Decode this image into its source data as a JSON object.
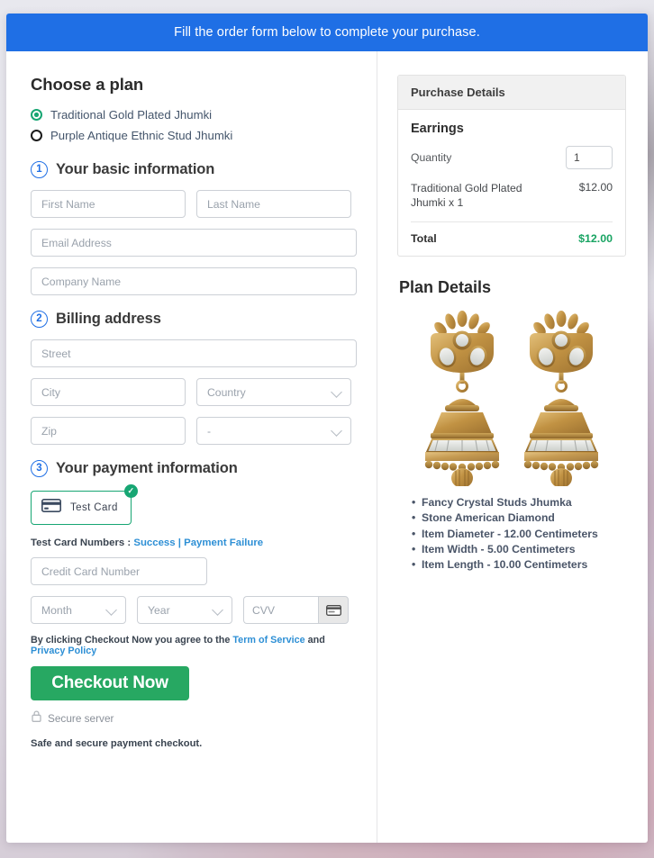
{
  "banner": {
    "text": "Fill the order form below to complete your purchase."
  },
  "plans": {
    "title": "Choose a plan",
    "options": [
      {
        "label": "Traditional Gold Plated Jhumki",
        "selected": true
      },
      {
        "label": "Purple Antique Ethnic Stud Jhumki",
        "selected": false
      }
    ]
  },
  "steps": {
    "basic": {
      "num": "1",
      "label": "Your basic information"
    },
    "billing": {
      "num": "2",
      "label": "Billing address"
    },
    "payment": {
      "num": "3",
      "label": "Your payment information"
    }
  },
  "fields": {
    "first_name": {
      "placeholder": "First Name",
      "value": ""
    },
    "last_name": {
      "placeholder": "Last Name",
      "value": ""
    },
    "email": {
      "placeholder": "Email Address",
      "value": ""
    },
    "company": {
      "placeholder": "Company Name",
      "value": ""
    },
    "street": {
      "placeholder": "Street",
      "value": ""
    },
    "city": {
      "placeholder": "City",
      "value": ""
    },
    "country": {
      "placeholder": "Country",
      "value": ""
    },
    "zip": {
      "placeholder": "Zip",
      "value": ""
    },
    "state": {
      "placeholder": "-",
      "value": "-"
    },
    "card_number": {
      "placeholder": "Credit Card Number",
      "value": ""
    },
    "month": {
      "placeholder": "Month",
      "value": ""
    },
    "year": {
      "placeholder": "Year",
      "value": ""
    },
    "cvv": {
      "placeholder": "CVV",
      "value": ""
    }
  },
  "payment": {
    "tile_label": "Test Card",
    "test_card_prefix": "Test Card Numbers :",
    "success_link": "Success",
    "separator": "|",
    "failure_link": "Payment Failure"
  },
  "footer": {
    "terms_prefix": "By clicking Checkout Now you agree to the",
    "terms_link": "Term of Service",
    "terms_and": "and",
    "privacy_link": "Privacy Policy",
    "checkout_button": "Checkout Now",
    "secure_server": "Secure server",
    "safe_note": "Safe and secure payment checkout."
  },
  "purchase": {
    "header": "Purchase Details",
    "product": "Earrings",
    "quantity_label": "Quantity",
    "quantity_value": "1",
    "line_item_name": "Traditional Gold Plated Jhumki x 1",
    "line_item_price": "$12.00",
    "total_label": "Total",
    "total_value": "$12.00"
  },
  "plan_details": {
    "title": "Plan Details",
    "features": [
      "Fancy Crystal Studs Jhumka",
      "Stone American Diamond",
      "Item Diameter - 12.00 Centimeters",
      "Item Width - 5.00 Centimeters",
      "Item Length - 10.00 Centimeters"
    ]
  },
  "colors": {
    "banner_blue": "#1f6fe5",
    "accent_green": "#17a673",
    "checkout_green": "#27a862",
    "link_blue": "#2d8fd5",
    "total_green": "#19a463"
  }
}
